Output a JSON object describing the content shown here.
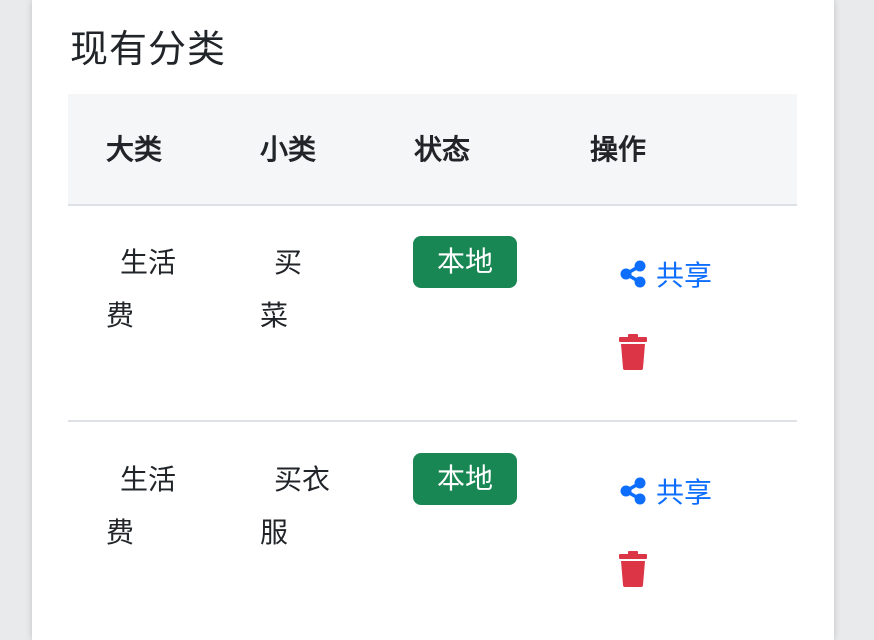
{
  "title": "现有分类",
  "table": {
    "headers": [
      "大类",
      "小类",
      "状态",
      "操作"
    ],
    "rows": [
      {
        "category": "生活费",
        "subcategory": "买菜",
        "status": "本地",
        "share_label": "共享"
      },
      {
        "category": "生活费",
        "subcategory": "买衣服",
        "status": "本地",
        "share_label": "共享"
      }
    ]
  },
  "colors": {
    "badge": "#198754",
    "link": "#0d6efd",
    "delete": "#dc3545"
  }
}
